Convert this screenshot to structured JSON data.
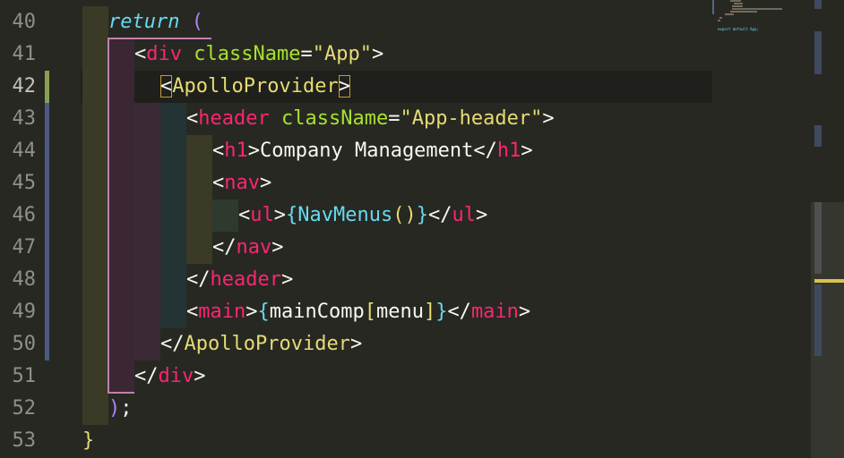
{
  "editor": {
    "active_line": "42",
    "lines": [
      {
        "num": "40",
        "text": "return ("
      },
      {
        "num": "41",
        "text": "<div className=\"App\">"
      },
      {
        "num": "42",
        "text": "<ApolloProvider>"
      },
      {
        "num": "43",
        "text": "<header className=\"App-header\">"
      },
      {
        "num": "44",
        "text": "<h1>Company Management</h1>"
      },
      {
        "num": "45",
        "text": "<nav>"
      },
      {
        "num": "46",
        "text": "<ul>{NavMenus()}</ul>"
      },
      {
        "num": "47",
        "text": "</nav>"
      },
      {
        "num": "48",
        "text": "</header>"
      },
      {
        "num": "49",
        "text": "<main>{mainComp[menu]}</main>"
      },
      {
        "num": "50",
        "text": "</ApolloProvider>"
      },
      {
        "num": "51",
        "text": "</div>"
      },
      {
        "num": "52",
        "text": ");"
      },
      {
        "num": "53",
        "text": "}"
      }
    ],
    "tokens": {
      "l40": [
        "return",
        " ",
        "("
      ],
      "l41": [
        "<",
        "div",
        " ",
        "className",
        "=",
        "\"App\"",
        ">"
      ],
      "l42": [
        "<",
        "ApolloProvider",
        ">"
      ],
      "l43": [
        "<",
        "header",
        " ",
        "className",
        "=",
        "\"App-header\"",
        ">"
      ],
      "l44": [
        "<",
        "h1",
        ">",
        "Company Management",
        "</",
        "h1",
        ">"
      ],
      "l45": [
        "<",
        "nav",
        ">"
      ],
      "l46": [
        "<",
        "ul",
        ">",
        "{",
        "NavMenus",
        "(",
        ")",
        "}",
        "</",
        "ul",
        ">"
      ],
      "l47": [
        "</",
        "nav",
        ">"
      ],
      "l48": [
        "</",
        "header",
        ">"
      ],
      "l49": [
        "<",
        "main",
        ">",
        "{",
        "mainComp",
        "[",
        "menu",
        "]",
        "}",
        "</",
        "main",
        ">"
      ],
      "l50": [
        "</",
        "ApolloProvider",
        ">"
      ],
      "l51": [
        "</",
        "div",
        ">"
      ],
      "l52": [
        ")",
        ";"
      ],
      "l53": [
        "}"
      ]
    }
  },
  "minimap": {
    "text_lines": [
      "export default App;"
    ]
  },
  "colors": {
    "background": "#272822",
    "line_highlight": "#1f201b",
    "git_modified": "#4b5b86",
    "git_added": "#8aa050",
    "tag": "#f92672",
    "attribute": "#a6e22e",
    "string": "#e6db74",
    "keyword": "#66d9ef",
    "paren": "#ae81ff"
  }
}
